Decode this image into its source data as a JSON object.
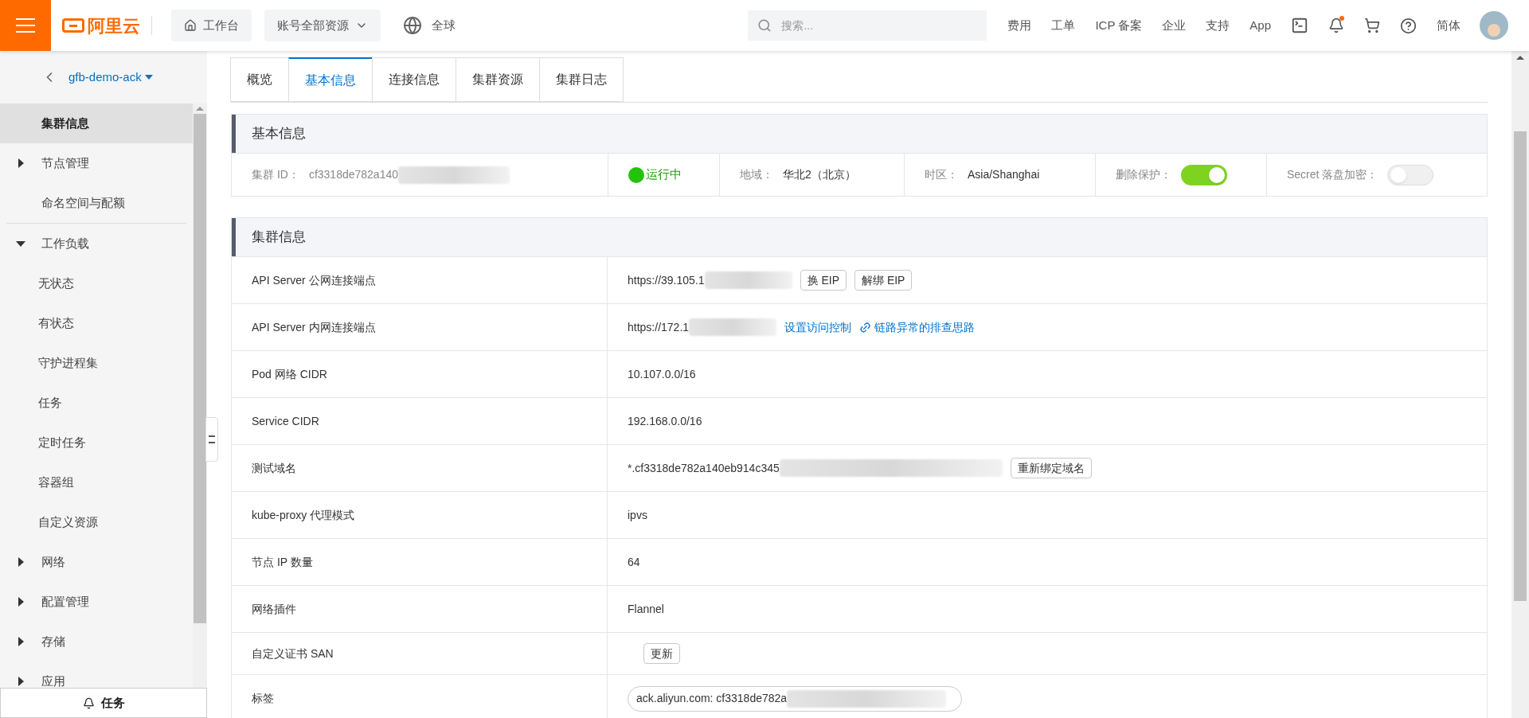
{
  "header": {
    "logo": "阿里云",
    "workbench": "工作台",
    "resources": "账号全部资源",
    "region": "全球",
    "search": {
      "placeholder": "搜索..."
    },
    "links": [
      "费用",
      "工单",
      "ICP 备案",
      "企业",
      "支持",
      "App"
    ],
    "bell_unread": true,
    "language": "简体"
  },
  "sidebar": {
    "cluster_name": "gfb-demo-ack",
    "items": [
      {
        "label": "集群信息",
        "kind": "leaf",
        "selected": true
      },
      {
        "label": "节点管理",
        "kind": "group",
        "expanded": false,
        "selected": false
      },
      {
        "label": "命名空间与配额",
        "kind": "leaf",
        "selected": false,
        "divider_after": true
      },
      {
        "label": "工作负载",
        "kind": "group",
        "expanded": true,
        "selected": false,
        "children": [
          {
            "label": "无状态",
            "selected": false
          },
          {
            "label": "有状态",
            "selected": false
          },
          {
            "label": "守护进程集",
            "selected": false
          },
          {
            "label": "任务",
            "selected": false
          },
          {
            "label": "定时任务",
            "selected": false
          },
          {
            "label": "容器组",
            "selected": false
          },
          {
            "label": "自定义资源",
            "selected": false
          }
        ]
      },
      {
        "label": "网络",
        "kind": "group",
        "expanded": false,
        "selected": false
      },
      {
        "label": "配置管理",
        "kind": "group",
        "expanded": false,
        "selected": false
      },
      {
        "label": "存储",
        "kind": "group",
        "expanded": false,
        "selected": false
      },
      {
        "label": "应用",
        "kind": "group",
        "expanded": false,
        "selected": false
      }
    ],
    "footer": "任务"
  },
  "tabs": [
    {
      "label": "概览",
      "selected": false
    },
    {
      "label": "基本信息",
      "selected": true
    },
    {
      "label": "连接信息",
      "selected": false
    },
    {
      "label": "集群资源",
      "selected": false
    },
    {
      "label": "集群日志",
      "selected": false
    }
  ],
  "basic_info": {
    "title": "基本信息",
    "cluster_id": {
      "label": "集群 ID：",
      "value": "cf3318de782a140"
    },
    "status": "运行中",
    "region": {
      "label": "地域：",
      "value": "华北2（北京）"
    },
    "timezone": {
      "label": "时区：",
      "value": "Asia/Shanghai"
    },
    "delete_protection": {
      "label": "删除保护：",
      "on": true
    },
    "secret_encryption": {
      "label": "Secret 落盘加密：",
      "on": false
    }
  },
  "cluster_info": {
    "title": "集群信息",
    "rows": [
      {
        "label": "API Server 公网连接端点",
        "value": "https://39.105.1",
        "redacted": true,
        "actions": [
          {
            "label": "换 EIP",
            "kind": "button"
          },
          {
            "label": "解绑 EIP",
            "kind": "button"
          }
        ]
      },
      {
        "label": "API Server 内网连接端点",
        "value": "https://172.1",
        "redacted": true,
        "actions": [
          {
            "label": "设置访问控制",
            "kind": "link"
          },
          {
            "label": "链路异常的排查思路",
            "kind": "help-link"
          }
        ]
      },
      {
        "label": "Pod 网络 CIDR",
        "value": "10.107.0.0/16",
        "redacted": false
      },
      {
        "label": "Service CIDR",
        "value": "192.168.0.0/16",
        "redacted": false
      },
      {
        "label": "测试域名",
        "value": "*.cf3318de782a140eb914c345",
        "redacted": true,
        "actions": [
          {
            "label": "重新绑定域名",
            "kind": "button"
          }
        ]
      },
      {
        "label": "kube-proxy 代理模式",
        "value": "ipvs",
        "redacted": false
      },
      {
        "label": "节点 IP 数量",
        "value": "64",
        "redacted": false
      },
      {
        "label": "网络插件",
        "value": "Flannel",
        "redacted": false
      },
      {
        "label": "自定义证书 SAN",
        "redacted": false,
        "actions": [
          {
            "label": "更新",
            "kind": "button"
          }
        ]
      },
      {
        "label": "标签",
        "value": "ack.aliyun.com: cf3318de782a",
        "kind": "tag",
        "redacted": true
      }
    ]
  }
}
